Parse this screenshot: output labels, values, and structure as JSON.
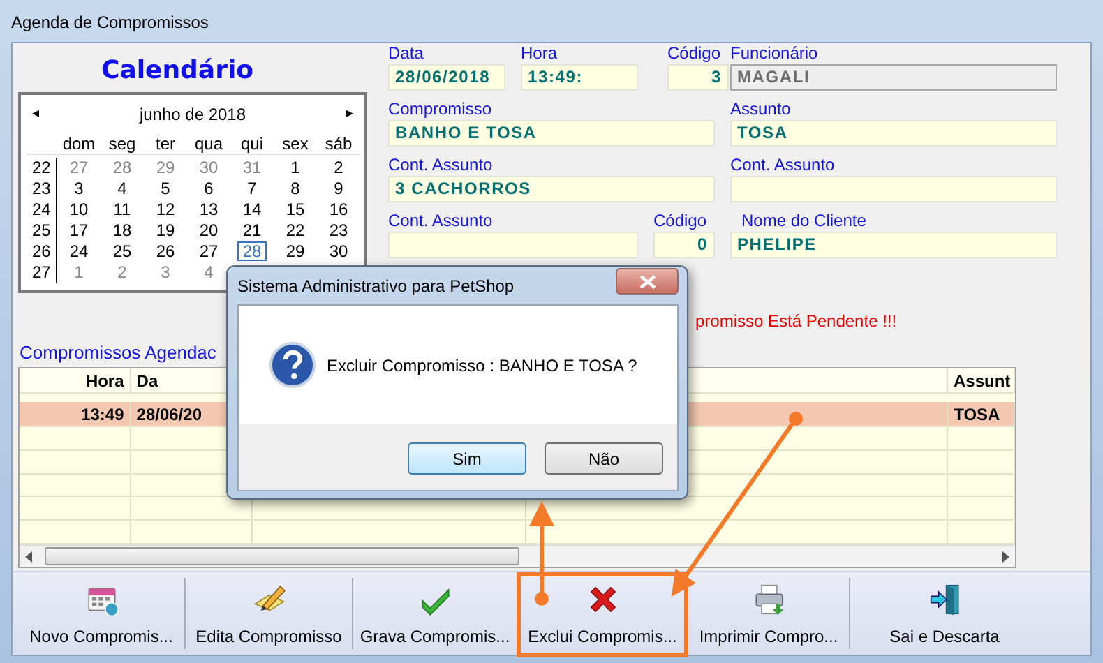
{
  "window": {
    "title": "Agenda de Compromissos"
  },
  "calendar": {
    "heading": "Calendário",
    "prev": "◂",
    "next": "▸",
    "month_label": "junho de 2018",
    "weekdays": [
      "dom",
      "seg",
      "ter",
      "qua",
      "qui",
      "sex",
      "sáb"
    ],
    "weeks": [
      {
        "number": "22",
        "days": [
          {
            "label": "27",
            "other_month": true,
            "selected": false
          },
          {
            "label": "28",
            "other_month": true,
            "selected": false
          },
          {
            "label": "29",
            "other_month": true,
            "selected": false
          },
          {
            "label": "30",
            "other_month": true,
            "selected": false
          },
          {
            "label": "31",
            "other_month": true,
            "selected": false
          },
          {
            "label": "1",
            "other_month": false,
            "selected": false
          },
          {
            "label": "2",
            "other_month": false,
            "selected": false
          }
        ]
      },
      {
        "number": "23",
        "days": [
          {
            "label": "3",
            "other_month": false,
            "selected": false
          },
          {
            "label": "4",
            "other_month": false,
            "selected": false
          },
          {
            "label": "5",
            "other_month": false,
            "selected": false
          },
          {
            "label": "6",
            "other_month": false,
            "selected": false
          },
          {
            "label": "7",
            "other_month": false,
            "selected": false
          },
          {
            "label": "8",
            "other_month": false,
            "selected": false
          },
          {
            "label": "9",
            "other_month": false,
            "selected": false
          }
        ]
      },
      {
        "number": "24",
        "days": [
          {
            "label": "10",
            "other_month": false,
            "selected": false
          },
          {
            "label": "11",
            "other_month": false,
            "selected": false
          },
          {
            "label": "12",
            "other_month": false,
            "selected": false
          },
          {
            "label": "13",
            "other_month": false,
            "selected": false
          },
          {
            "label": "14",
            "other_month": false,
            "selected": false
          },
          {
            "label": "15",
            "other_month": false,
            "selected": false
          },
          {
            "label": "16",
            "other_month": false,
            "selected": false
          }
        ]
      },
      {
        "number": "25",
        "days": [
          {
            "label": "17",
            "other_month": false,
            "selected": false
          },
          {
            "label": "18",
            "other_month": false,
            "selected": false
          },
          {
            "label": "19",
            "other_month": false,
            "selected": false
          },
          {
            "label": "20",
            "other_month": false,
            "selected": false
          },
          {
            "label": "21",
            "other_month": false,
            "selected": false
          },
          {
            "label": "22",
            "other_month": false,
            "selected": false
          },
          {
            "label": "23",
            "other_month": false,
            "selected": false
          }
        ]
      },
      {
        "number": "26",
        "days": [
          {
            "label": "24",
            "other_month": false,
            "selected": false
          },
          {
            "label": "25",
            "other_month": false,
            "selected": false
          },
          {
            "label": "26",
            "other_month": false,
            "selected": false
          },
          {
            "label": "27",
            "other_month": false,
            "selected": false
          },
          {
            "label": "28",
            "other_month": false,
            "selected": true
          },
          {
            "label": "29",
            "other_month": false,
            "selected": false
          },
          {
            "label": "30",
            "other_month": false,
            "selected": false
          }
        ]
      },
      {
        "number": "27",
        "days": [
          {
            "label": "1",
            "other_month": true,
            "selected": false
          },
          {
            "label": "2",
            "other_month": true,
            "selected": false
          },
          {
            "label": "3",
            "other_month": true,
            "selected": false
          },
          {
            "label": "4",
            "other_month": true,
            "selected": false
          }
        ]
      }
    ]
  },
  "form_rows": [
    [
      {
        "label": "Data",
        "value": "28/06/2018",
        "kind": "text",
        "disabled": false
      },
      {
        "label": "Hora",
        "value": "13:49:",
        "kind": "text",
        "disabled": false
      },
      {
        "label": "Código",
        "value": "3",
        "kind": "number",
        "disabled": false
      },
      {
        "label": "Funcionário",
        "value": "MAGALI",
        "kind": "text",
        "disabled": true
      }
    ],
    [
      {
        "label": "Compromisso",
        "value": "BANHO E TOSA",
        "kind": "text",
        "disabled": false
      },
      {
        "label": "Assunto",
        "value": "TOSA",
        "kind": "text",
        "disabled": false
      }
    ],
    [
      {
        "label": "Cont. Assunto",
        "value": "3 CACHORROS",
        "kind": "text",
        "disabled": false
      },
      {
        "label": "Cont. Assunto",
        "kind": "text",
        "disabled": false
      }
    ],
    [
      {
        "label": "Cont. Assunto",
        "kind": "text",
        "disabled": false
      },
      {
        "label": "Código",
        "value": "0",
        "kind": "number",
        "disabled": false
      },
      {
        "label": "Nome do Cliente",
        "value": "PHELIPE",
        "kind": "text",
        "disabled": false
      }
    ]
  ],
  "status_message": "promisso Está Pendente !!!",
  "table": {
    "title": "Compromissos Agendac",
    "columns": [
      {
        "label": "Hora"
      },
      {
        "label": "Da"
      },
      {
        "label": "Assunt"
      }
    ],
    "rows": [
      {
        "cells": [
          "13:49",
          "28/06/20",
          "TOSA"
        ],
        "selected": true
      }
    ]
  },
  "toolbar": [
    {
      "label": "Novo Compromis...",
      "kind": "new"
    },
    {
      "label": "Edita Compromisso",
      "kind": "edit"
    },
    {
      "label": "Grava Compromis...",
      "kind": "save"
    },
    {
      "label": "Exclui Compromis...",
      "kind": "delete"
    },
    {
      "label": "Imprimir Compro...",
      "kind": "print"
    },
    {
      "label": "Sai e Descarta",
      "kind": "exit"
    }
  ],
  "dialog": {
    "title": "Sistema Administrativo para PetShop",
    "message": "Excluir Compromisso : BANHO E TOSA ?",
    "buttons": [
      {
        "label": "Sim",
        "default": true
      },
      {
        "label": "Não",
        "default": false
      }
    ]
  }
}
